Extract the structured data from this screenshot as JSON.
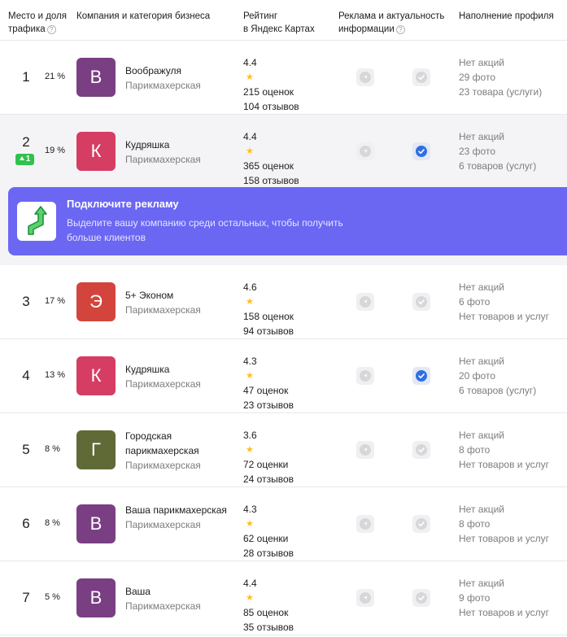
{
  "header": {
    "place": "Место и доля трафика",
    "company": "Компания и категория бизнеса",
    "rating_line1": "Рейтинг",
    "rating_line2": "в Яндекс Картах",
    "ads": "Реклама и актуальность информации",
    "profile": "Наполнение профиля",
    "help_glyph": "?"
  },
  "promo": {
    "title": "Подключите рекламу",
    "text": "Выделите вашу компанию среди остальных, чтобы получить больше клиентов"
  },
  "colors": {
    "purple": "#7a3f83",
    "pink": "#d63d62",
    "red": "#d3453c",
    "olive": "#5f6a37",
    "promo": "#6b67f3",
    "check": "#2f6fe4",
    "badge": "#30c24c"
  },
  "rows": [
    {
      "place": "1",
      "share": "21 %",
      "letter": "В",
      "name": "Воображуля",
      "category": "Парикмахерская",
      "rating": "4.4",
      "ratings_count": "215 оценок",
      "reviews": "104 отзывов",
      "info_verified": false,
      "promo": "Нет акций",
      "photos": "29 фото",
      "goods": "23 товара (услуги)"
    },
    {
      "place": "2",
      "share": "19 %",
      "badge": "1",
      "letter": "К",
      "name": "Кудряшка",
      "category": "Парикмахерская",
      "rating": "4.4",
      "ratings_count": "365 оценок",
      "reviews": "158 отзывов",
      "info_verified": true,
      "promo": "Нет акций",
      "photos": "23 фото",
      "goods": "6 товаров (услуг)"
    },
    {
      "place": "3",
      "share": "17 %",
      "letter": "Э",
      "name": "5+ Эконом",
      "category": "Парикмахерская",
      "rating": "4.6",
      "ratings_count": "158 оценок",
      "reviews": "94 отзывов",
      "info_verified": false,
      "promo": "Нет акций",
      "photos": "6 фото",
      "goods": "Нет товаров и услуг"
    },
    {
      "place": "4",
      "share": "13 %",
      "letter": "К",
      "name": "Кудряшка",
      "category": "Парикмахерская",
      "rating": "4.3",
      "ratings_count": "47 оценок",
      "reviews": "23 отзывов",
      "info_verified": true,
      "promo": "Нет акций",
      "photos": "20 фото",
      "goods": "6 товаров (услуг)"
    },
    {
      "place": "5",
      "share": "8 %",
      "letter": "Г",
      "name": "Городская парикмахерская",
      "category": "Парикмахерская",
      "rating": "3.6",
      "ratings_count": "72 оценки",
      "reviews": "24 отзывов",
      "info_verified": false,
      "promo": "Нет акций",
      "photos": "8 фото",
      "goods": "Нет товаров и услуг"
    },
    {
      "place": "6",
      "share": "8 %",
      "letter": "В",
      "name": "Ваша парикмахерская",
      "category": "Парикмахерская",
      "rating": "4.3",
      "ratings_count": "62 оценки",
      "reviews": "28 отзывов",
      "info_verified": false,
      "promo": "Нет акций",
      "photos": "8 фото",
      "goods": "Нет товаров и услуг"
    },
    {
      "place": "7",
      "share": "5 %",
      "letter": "В",
      "name": "Ваша",
      "category": "Парикмахерская",
      "rating": "4.4",
      "ratings_count": "85 оценок",
      "reviews": "35 отзывов",
      "info_verified": false,
      "promo": "Нет акций",
      "photos": "9 фото",
      "goods": "Нет товаров и услуг"
    }
  ]
}
